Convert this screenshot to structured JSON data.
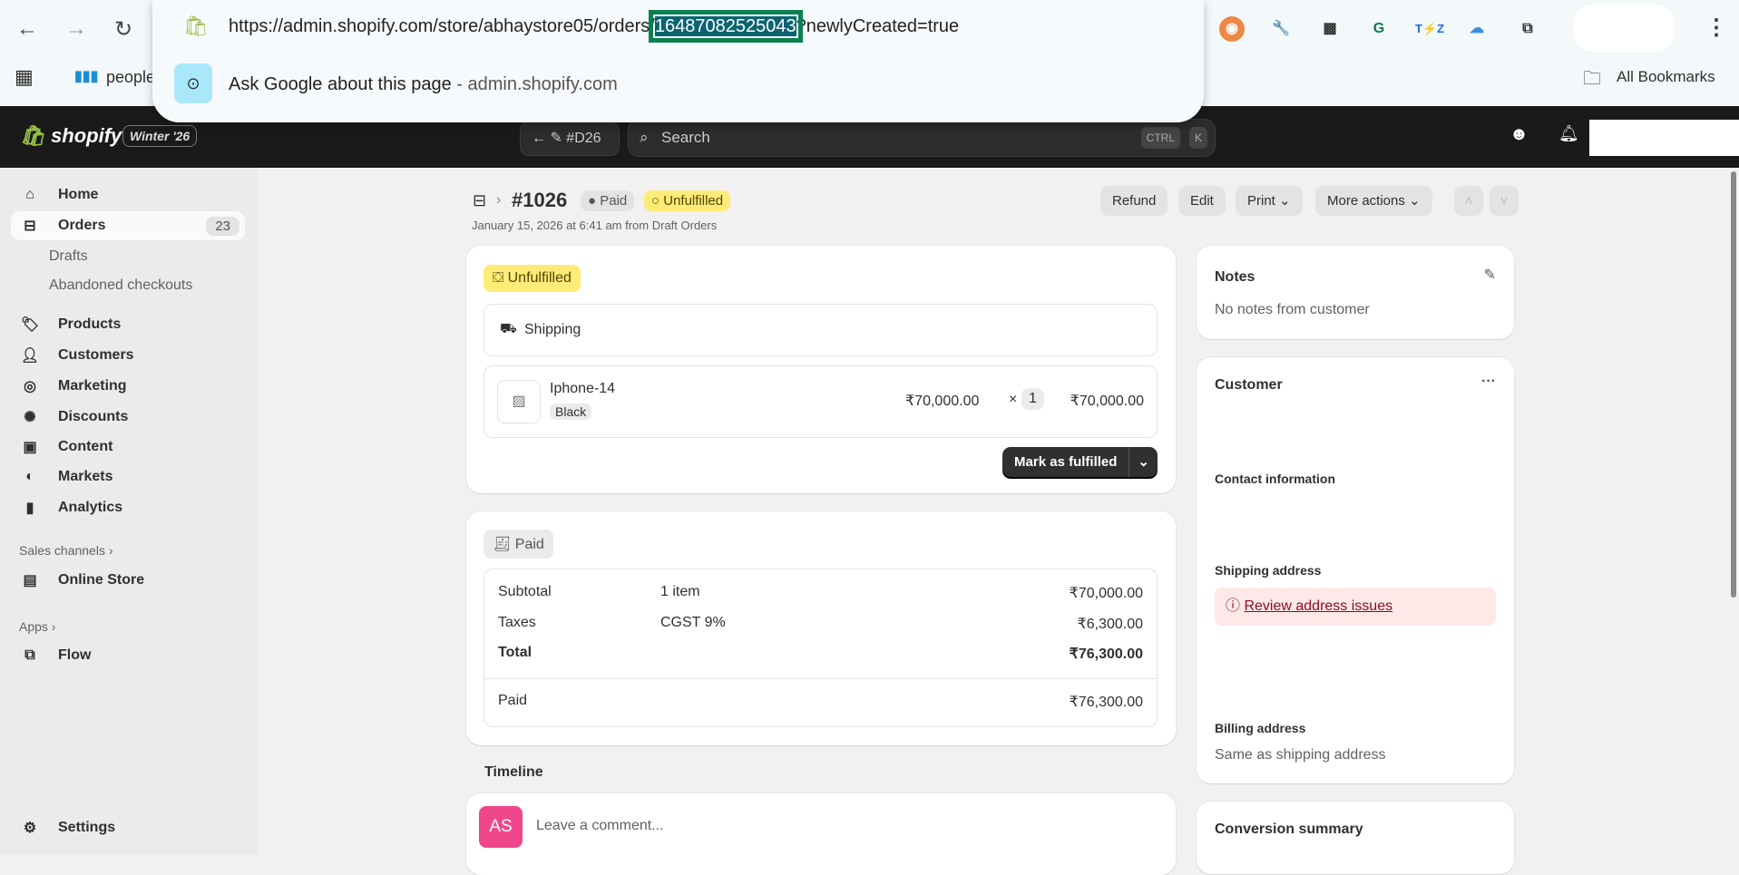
{
  "browser": {
    "url_prefix": "https://admin.shopify.com/store/abhaystore05/orders/",
    "url_id": "16487082525043",
    "url_suffix": "?newlyCreated=true",
    "suggestion": "Ask Google about this page",
    "suggestion_domain": " - admin.shopify.com",
    "bookmark": "people",
    "all_bookmarks": "All Bookmarks"
  },
  "topbar": {
    "brand": "shopify",
    "edition": "Winter '26",
    "order_pill": "#D26",
    "search_placeholder": "Search",
    "kbd1": "CTRL",
    "kbd2": "K"
  },
  "sidebar": {
    "home": "Home",
    "orders": "Orders",
    "orders_count": "23",
    "drafts": "Drafts",
    "abandoned": "Abandoned checkouts",
    "products": "Products",
    "customers": "Customers",
    "marketing": "Marketing",
    "discounts": "Discounts",
    "content": "Content",
    "markets": "Markets",
    "analytics": "Analytics",
    "sales_channels": "Sales channels",
    "online_store": "Online Store",
    "apps": "Apps",
    "flow": "Flow",
    "settings": "Settings"
  },
  "order": {
    "number": "#1026",
    "payment_badge": "Paid",
    "fulfillment_badge": "Unfulfilled",
    "meta": "January 15, 2026 at 6:41 am from Draft Orders",
    "actions": {
      "refund": "Refund",
      "edit": "Edit",
      "print": "Print",
      "more": "More actions"
    },
    "fulfillment": {
      "status": "Unfulfilled",
      "method": "Shipping",
      "item_name": "Iphone-14",
      "variant": "Black",
      "unit_price": "₹70,000.00",
      "times": "×",
      "qty": "1",
      "line_total": "₹70,000.00",
      "mark_button": "Mark as fulfilled"
    },
    "payment": {
      "status": "Paid",
      "rows": [
        {
          "label": "Subtotal",
          "desc": "1 item",
          "amount": "₹70,000.00"
        },
        {
          "label": "Taxes",
          "desc": "CGST 9%",
          "amount": "₹6,300.00"
        },
        {
          "label": "Total",
          "desc": "",
          "amount": "₹76,300.00"
        }
      ],
      "paid_label": "Paid",
      "paid_amount": "₹76,300.00"
    },
    "timeline": {
      "title": "Timeline",
      "avatar": "AS",
      "placeholder": "Leave a comment..."
    }
  },
  "notes": {
    "title": "Notes",
    "body": "No notes from customer"
  },
  "customer": {
    "title": "Customer",
    "contact": "Contact information",
    "shipping": "Shipping address",
    "review": "Review address issues",
    "billing": "Billing address",
    "billing_value": "Same as shipping address"
  },
  "conversion": {
    "title": "Conversion summary"
  }
}
